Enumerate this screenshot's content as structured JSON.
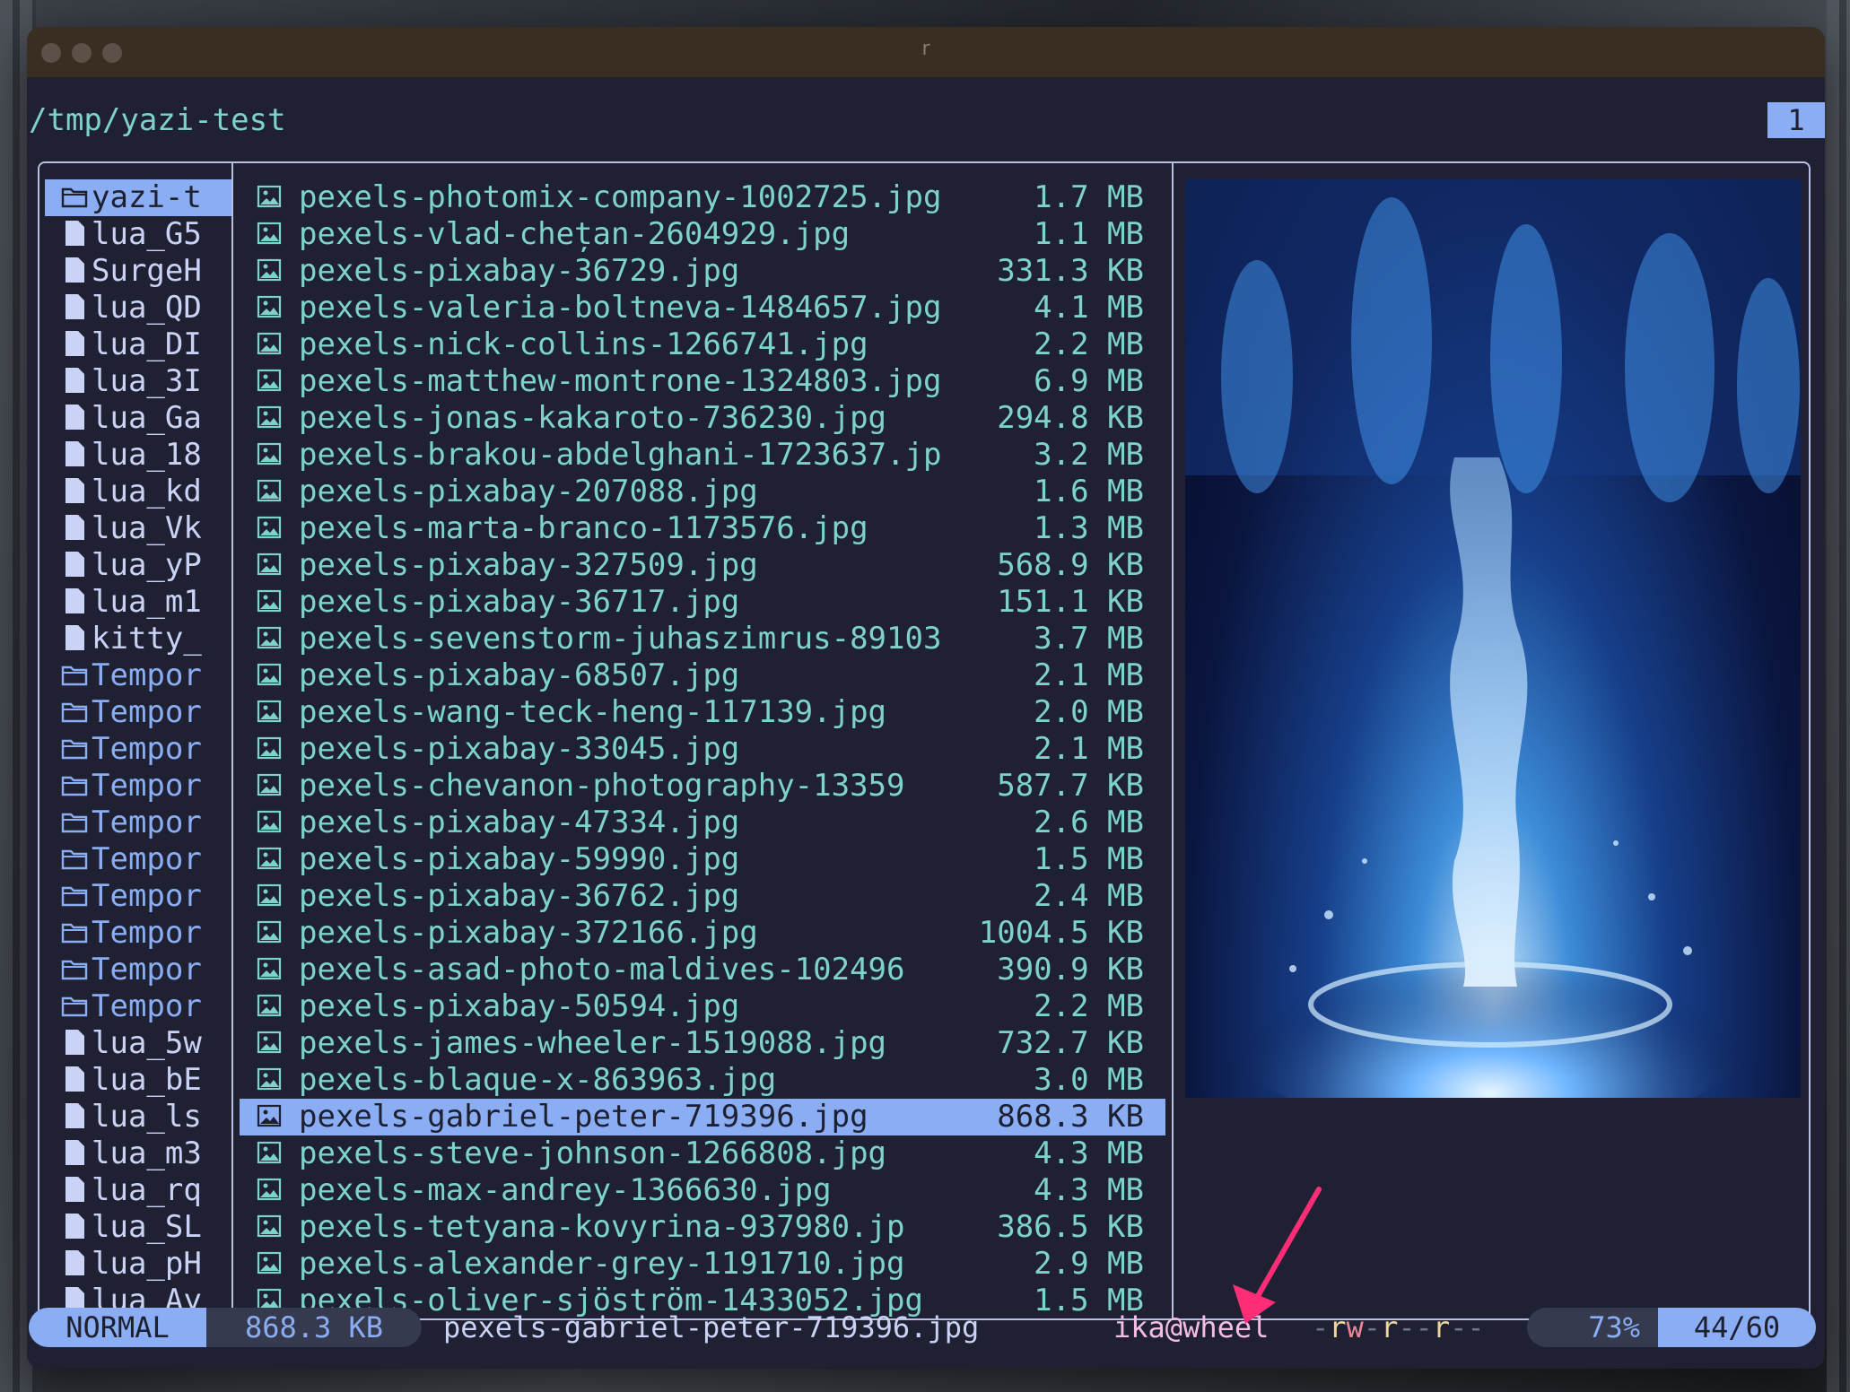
{
  "window": {
    "title": "r"
  },
  "header": {
    "path": "/tmp/yazi-test",
    "tab": "1"
  },
  "parent": [
    {
      "name": "yazi-t",
      "type": "dir",
      "hl": true
    },
    {
      "name": "lua_G5",
      "type": "file"
    },
    {
      "name": "SurgeH",
      "type": "file"
    },
    {
      "name": "lua_QD",
      "type": "file"
    },
    {
      "name": "lua_DI",
      "type": "file"
    },
    {
      "name": "lua_3I",
      "type": "file"
    },
    {
      "name": "lua_Ga",
      "type": "file"
    },
    {
      "name": "lua_18",
      "type": "file"
    },
    {
      "name": "lua_kd",
      "type": "file"
    },
    {
      "name": "lua_Vk",
      "type": "file"
    },
    {
      "name": "lua_yP",
      "type": "file"
    },
    {
      "name": "lua_m1",
      "type": "file"
    },
    {
      "name": "kitty_",
      "type": "file"
    },
    {
      "name": "Tempor",
      "type": "dir"
    },
    {
      "name": "Tempor",
      "type": "dir"
    },
    {
      "name": "Tempor",
      "type": "dir"
    },
    {
      "name": "Tempor",
      "type": "dir"
    },
    {
      "name": "Tempor",
      "type": "dir"
    },
    {
      "name": "Tempor",
      "type": "dir"
    },
    {
      "name": "Tempor",
      "type": "dir"
    },
    {
      "name": "Tempor",
      "type": "dir"
    },
    {
      "name": "Tempor",
      "type": "dir"
    },
    {
      "name": "Tempor",
      "type": "dir"
    },
    {
      "name": "lua_5w",
      "type": "file"
    },
    {
      "name": "lua_bE",
      "type": "file"
    },
    {
      "name": "lua_ls",
      "type": "file"
    },
    {
      "name": "lua_m3",
      "type": "file"
    },
    {
      "name": "lua_rq",
      "type": "file"
    },
    {
      "name": "lua_SL",
      "type": "file"
    },
    {
      "name": "lua_pH",
      "type": "file"
    },
    {
      "name": "lua_Ay",
      "type": "file"
    }
  ],
  "files": [
    {
      "name": "pexels-photomix-company-1002725.jpg",
      "size": "1.7 MB"
    },
    {
      "name": "pexels-vlad-chețan-2604929.jpg",
      "size": "1.1 MB"
    },
    {
      "name": "pexels-pixabay-36729.jpg",
      "size": "331.3 KB"
    },
    {
      "name": "pexels-valeria-boltneva-1484657.jpg",
      "size": "4.1 MB"
    },
    {
      "name": "pexels-nick-collins-1266741.jpg",
      "size": "2.2 MB"
    },
    {
      "name": "pexels-matthew-montrone-1324803.jpg",
      "size": "6.9 MB"
    },
    {
      "name": "pexels-jonas-kakaroto-736230.jpg",
      "size": "294.8 KB"
    },
    {
      "name": "pexels-brakou-abdelghani-1723637.jp",
      "size": "3.2 MB"
    },
    {
      "name": "pexels-pixabay-207088.jpg",
      "size": "1.6 MB"
    },
    {
      "name": "pexels-marta-branco-1173576.jpg",
      "size": "1.3 MB"
    },
    {
      "name": "pexels-pixabay-327509.jpg",
      "size": "568.9 KB"
    },
    {
      "name": "pexels-pixabay-36717.jpg",
      "size": "151.1 KB"
    },
    {
      "name": "pexels-sevenstorm-juhaszimrus-89103",
      "size": "3.7 MB"
    },
    {
      "name": "pexels-pixabay-68507.jpg",
      "size": "2.1 MB"
    },
    {
      "name": "pexels-wang-teck-heng-117139.jpg",
      "size": "2.0 MB"
    },
    {
      "name": "pexels-pixabay-33045.jpg",
      "size": "2.1 MB"
    },
    {
      "name": "pexels-chevanon-photography-13359",
      "size": "587.7 KB"
    },
    {
      "name": "pexels-pixabay-47334.jpg",
      "size": "2.6 MB"
    },
    {
      "name": "pexels-pixabay-59990.jpg",
      "size": "1.5 MB"
    },
    {
      "name": "pexels-pixabay-36762.jpg",
      "size": "2.4 MB"
    },
    {
      "name": "pexels-pixabay-372166.jpg",
      "size": "1004.5 KB"
    },
    {
      "name": "pexels-asad-photo-maldives-102496",
      "size": "390.9 KB"
    },
    {
      "name": "pexels-pixabay-50594.jpg",
      "size": "2.2 MB"
    },
    {
      "name": "pexels-james-wheeler-1519088.jpg",
      "size": "732.7 KB"
    },
    {
      "name": "pexels-blaque-x-863963.jpg",
      "size": "3.0 MB"
    },
    {
      "name": "pexels-gabriel-peter-719396.jpg",
      "size": "868.3 KB",
      "hl": true
    },
    {
      "name": "pexels-steve-johnson-1266808.jpg",
      "size": "4.3 MB"
    },
    {
      "name": "pexels-max-andrey-1366630.jpg",
      "size": "4.3 MB"
    },
    {
      "name": "pexels-tetyana-kovyrina-937980.jp",
      "size": "386.5 KB"
    },
    {
      "name": "pexels-alexander-grey-1191710.jpg",
      "size": "2.9 MB"
    },
    {
      "name": "pexels-oliver-sjöström-1433052.jpg",
      "size": "1.5 MB"
    }
  ],
  "status": {
    "mode": "NORMAL",
    "size": "868.3 KB",
    "filename": "pexels-gabriel-peter-719396.jpg",
    "owner": "ika@wheel",
    "perm": "-rw-r--r--",
    "percent": "73%",
    "position": "44/60"
  },
  "colors": {
    "accent": "#8aadf4",
    "file_teal": "#7dd3c8",
    "arrow": "#ff2d78"
  },
  "icons": {
    "dir": "folder-icon",
    "file": "file-icon",
    "image": "image-file-icon"
  }
}
